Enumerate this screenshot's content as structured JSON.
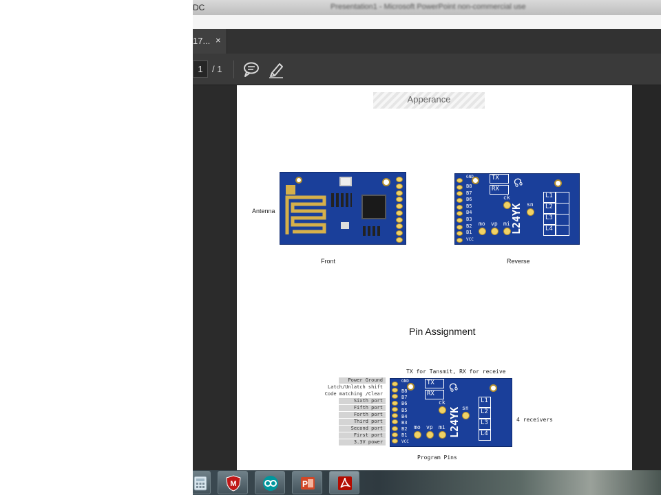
{
  "window": {
    "app_abbrev": "DC",
    "title_text": "Presentation1 - Microsoft PowerPoint non-commercial use"
  },
  "tabs": [
    {
      "label": "17...",
      "close": "×"
    }
  ],
  "toolbar": {
    "page_current": "1",
    "page_total": "/ 1",
    "icons": [
      "comment-icon",
      "highlight-pen-icon"
    ]
  },
  "document": {
    "appearance_title": "Apperance",
    "antenna_label": "Antenna",
    "front_label": "Front",
    "reverse_label": "Reverse",
    "pin_assignment_title": "Pin Assignment",
    "tx_rx_note": "TX for Tansmit, RX for receive",
    "receivers_note": "4 receivers",
    "program_pins_note": "Program Pins",
    "module_model": "L24YK",
    "silk": {
      "gnd": "GND",
      "pins": [
        "B8",
        "B7",
        "B6",
        "B5",
        "B4",
        "B3",
        "B2",
        "B1"
      ],
      "vcc": "VCC",
      "tx": "TX",
      "rx": "RX",
      "ck": "ck",
      "sn": "sn",
      "mo": "mo",
      "vp": "vp",
      "mi": "mi",
      "outputs": [
        "L1",
        "L2",
        "L3",
        "L4"
      ]
    },
    "pin_labels": [
      "Power Ground",
      "Latch/Unlatch shift",
      "Code matching /Clear",
      "Sixth port",
      "Fifth port",
      "Forth port",
      "Third port",
      "Second port",
      "First port",
      "3.3V power"
    ]
  },
  "taskbar": {
    "items": [
      "calculator-icon",
      "mcafee-icon",
      "arduino-icon",
      "ppt-icon",
      "acrobat-icon"
    ]
  },
  "colors": {
    "pcb_blue": "#1a3f9a",
    "gold": "#caa33a",
    "acrobat_red": "#b30b00",
    "arduino_teal": "#00979d"
  }
}
